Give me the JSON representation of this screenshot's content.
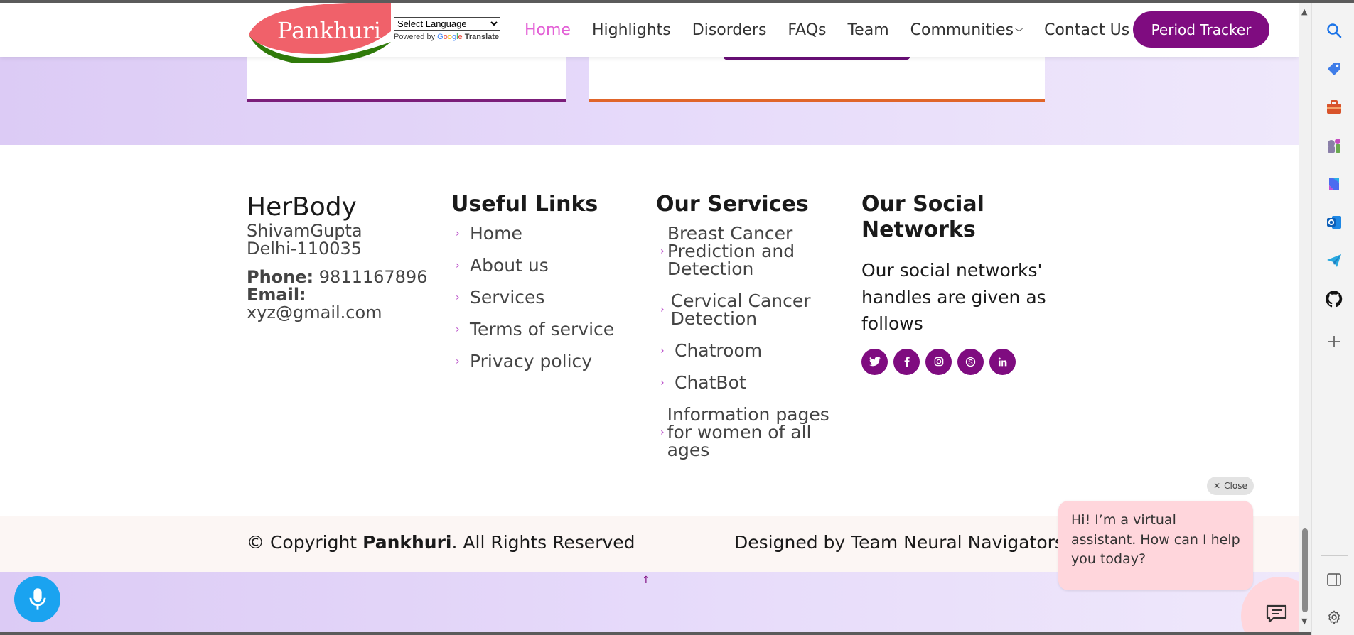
{
  "brand": {
    "logo_text": "Pankhuri"
  },
  "translate": {
    "select_label": "Select Language",
    "powered_by": "Powered by",
    "google": "Google",
    "translate": "Translate"
  },
  "nav": {
    "items": [
      {
        "label": "Home",
        "active": true
      },
      {
        "label": "Highlights"
      },
      {
        "label": "Disorders"
      },
      {
        "label": "FAQs"
      },
      {
        "label": "Team"
      },
      {
        "label": "Communities",
        "has_dropdown": true
      },
      {
        "label": "Contact Us"
      }
    ],
    "cta": "Period Tracker"
  },
  "footer": {
    "about": {
      "title": "HerBody",
      "address_line1": "ShivamGupta",
      "address_line2": "Delhi-110035",
      "phone_label": "Phone:",
      "phone": "9811167896",
      "email_label": "Email:",
      "email": "xyz@gmail.com"
    },
    "useful_links": {
      "title": "Useful Links",
      "items": [
        "Home",
        "About us",
        "Services",
        "Terms of service",
        "Privacy policy"
      ]
    },
    "services": {
      "title": "Our Services",
      "items": [
        "Breast Cancer Prediction and Detection",
        "Cervical Cancer Detection",
        "Chatroom",
        "ChatBot",
        "Information pages for women of all ages"
      ]
    },
    "social": {
      "title": "Our Social Networks",
      "description": "Our social networks' handles are given as follows",
      "icons": [
        "twitter-icon",
        "facebook-icon",
        "instagram-icon",
        "skype-icon",
        "linkedin-icon"
      ]
    }
  },
  "copyright": {
    "prefix": "© Copyright",
    "brand": "Pankhuri",
    "suffix": ". All Rights Reserved",
    "designed_by": "Designed by Team Neural Navigators"
  },
  "assistant": {
    "close_label": "Close",
    "message": "Hi! I’m a virtual assistant. How can I help you today?"
  },
  "colors": {
    "accent": "#7f0c80",
    "nav_active": "#e361d6",
    "assistant_bg": "#ffd6dc",
    "mic": "#1aa3f0"
  }
}
